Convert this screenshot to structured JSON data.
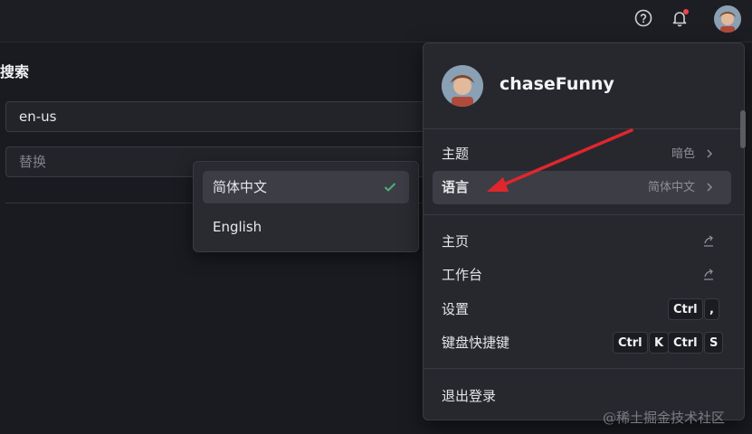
{
  "header": {
    "icons": [
      "help-icon",
      "bell-icon",
      "avatar"
    ]
  },
  "search": {
    "title": "搜索",
    "language_value": "en-us",
    "replace_placeholder": "替换"
  },
  "language_popover": {
    "options": [
      {
        "label": "简体中文",
        "selected": true
      },
      {
        "label": "English",
        "selected": false
      }
    ]
  },
  "user_menu": {
    "username": "chaseFunny",
    "items": [
      {
        "label": "主题",
        "value": "暗色",
        "icon": "chevron-right-icon"
      },
      {
        "label": "语言",
        "value": "简体中文",
        "icon": "chevron-right-icon",
        "highlighted": true
      },
      {
        "label": "主页",
        "icon": "external-link-icon"
      },
      {
        "label": "工作台",
        "icon": "external-link-icon"
      },
      {
        "label": "设置",
        "shortcut": [
          "Ctrl",
          ","
        ]
      },
      {
        "label": "键盘快捷键",
        "shortcut": [
          "Ctrl",
          "K",
          "Ctrl",
          "S"
        ]
      },
      {
        "label": "退出登录"
      }
    ]
  },
  "watermark": "@稀土掘金技术社区",
  "colors": {
    "background": "#1a1b20",
    "panel": "#27282e",
    "highlight": "#3c3d45",
    "arrow": "#e0262d",
    "check": "#4cae7a",
    "notification_dot": "#e8474a"
  }
}
